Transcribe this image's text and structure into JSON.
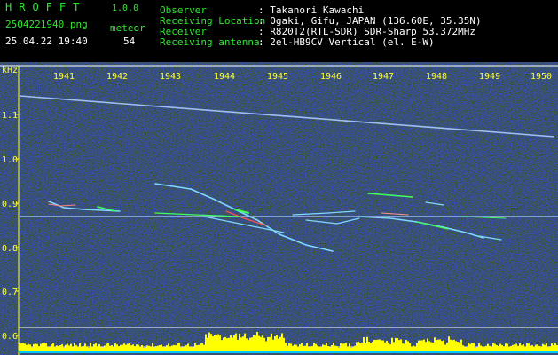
{
  "header": {
    "logo": "HROFFT",
    "version": "1.0.0",
    "filename": "2504221940.png",
    "datetime": "25.04.22 19:40",
    "count_label": "meteor",
    "count_value": "54",
    "fields": [
      {
        "label": "Observer",
        "value": ": Takanori Kawachi"
      },
      {
        "label": "Receiving Location",
        "value": ": Ogaki, Gifu, JAPAN (136.60E, 35.35N)"
      },
      {
        "label": "Receiver",
        "value": ": R820T2(RTL-SDR) SDR-Sharp 53.372MHz"
      },
      {
        "label": "Receiving antenna",
        "value": ": 2el-HB9CV Vertical (el. E-W)"
      }
    ]
  },
  "axis": {
    "unit": "kHz",
    "time_ticks": [
      "1941",
      "1942",
      "1943",
      "1944",
      "1945",
      "1946",
      "1947",
      "1948",
      "1949",
      "1950"
    ],
    "freq_ticks": [
      "1.1",
      "1.0",
      "0.9",
      "0.8",
      "0.7",
      "0.6"
    ]
  },
  "colors": {
    "background": "#0a0a5a",
    "text_header": "#2ee82e",
    "text_axis": "#ffff33",
    "carrier": "#aaccff",
    "meteor": "#7fd8ff",
    "echo_hot": "#ff5050",
    "echo_green": "#40ff60",
    "histogram": "#ffff00",
    "baseline": "#00c8ff"
  }
}
